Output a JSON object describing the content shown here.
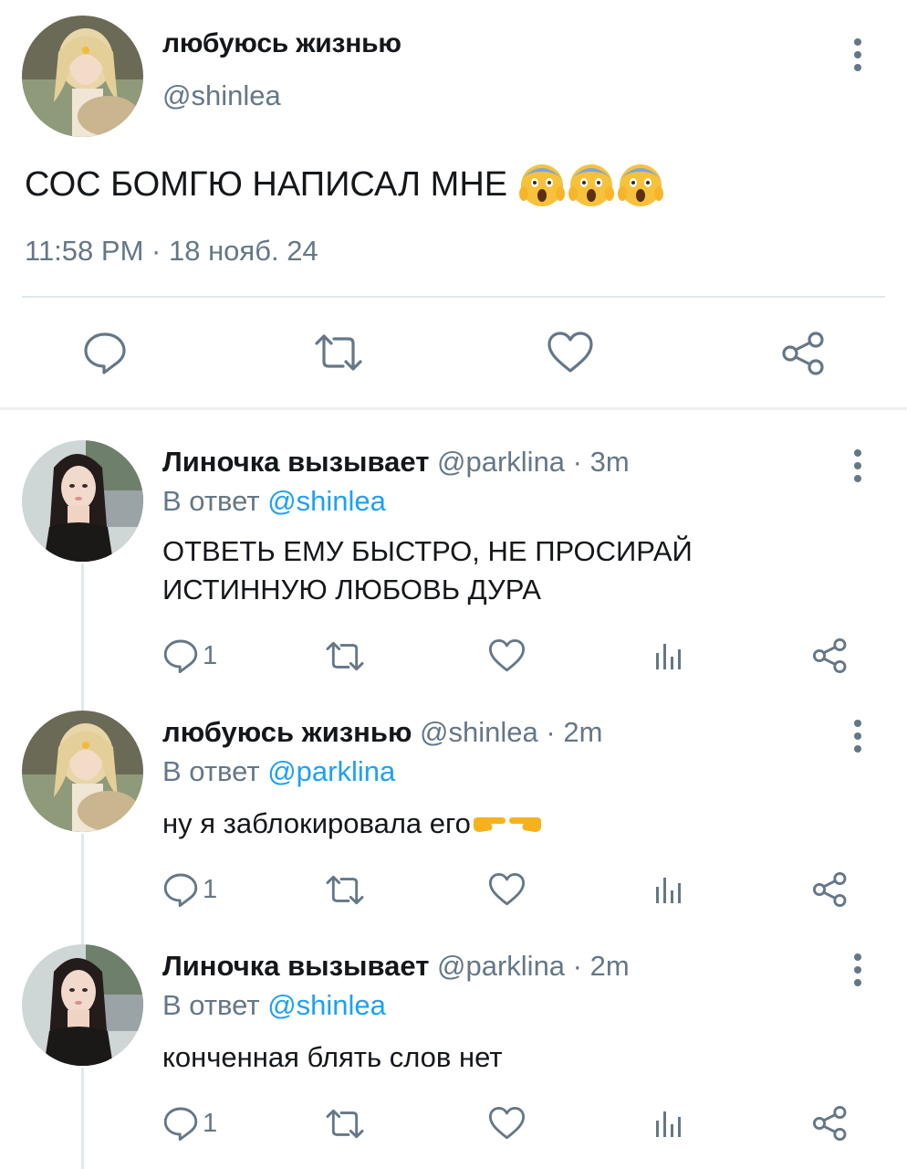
{
  "main_tweet": {
    "display_name": "любуюсь жизнью",
    "handle": "@shinlea",
    "text": "СОС БОМГЮ НАПИСАЛ МНЕ",
    "time": "11:58 PM",
    "separator": "·",
    "date": "18 нояб. 24",
    "emoji_names": [
      "face-screaming-in-fear",
      "face-screaming-in-fear",
      "face-screaming-in-fear"
    ],
    "actions": [
      "reply-icon",
      "retweet-icon",
      "like-icon",
      "share-icon"
    ]
  },
  "replies": [
    {
      "display_name": "Линочка вызывает",
      "handle": "@parklina",
      "separator": "·",
      "time": "3m",
      "reply_label": "В ответ",
      "reply_to": "@shinlea",
      "text_lines": [
        "ОТВЕТЬ ЕМУ БЫСТРО, НЕ ПРОСИРАЙ",
        "ИСТИННУЮ ЛЮБОВЬ ДУРА"
      ],
      "reply_count": "1"
    },
    {
      "display_name": "любуюсь жизнью",
      "handle": "@shinlea",
      "separator": "·",
      "time": "2m",
      "reply_label": "В ответ",
      "reply_to": "@parklina",
      "text_lines": [
        "ну я заблокировала его"
      ],
      "emoji_names": [
        "backhand-index-pointing-right",
        "backhand-index-pointing-left"
      ],
      "reply_count": "1"
    },
    {
      "display_name": "Линочка вызывает",
      "handle": "@parklina",
      "separator": "·",
      "time": "2m",
      "reply_label": "В ответ",
      "reply_to": "@shinlea",
      "text_lines": [
        "конченная блять слов нет"
      ],
      "reply_count": "1"
    }
  ],
  "colors": {
    "text_primary": "#14171a",
    "text_secondary": "#657786",
    "link": "#1da1f2",
    "divider": "#e1e8ed"
  }
}
